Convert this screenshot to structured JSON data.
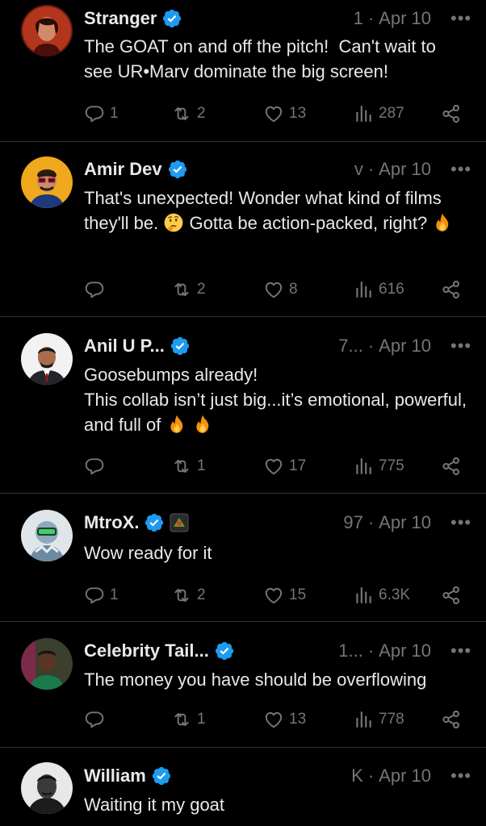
{
  "colors": {
    "background": "#000000",
    "text": "#e7e9ea",
    "muted": "#71767b",
    "verified": "#1d9bf0",
    "divider": "#2f3336"
  },
  "tweets": [
    {
      "name": "Stranger",
      "handle": "1",
      "date": "Apr 10",
      "text": "The GOAT on and off the pitch!  Can't wait to see UR•Marv dominate the big screen!",
      "replies": "1",
      "retweets": "2",
      "likes": "13",
      "views": "287"
    },
    {
      "name": "Amir Dev",
      "handle": "v",
      "date": "Apr 10",
      "text_a": "That's unexpected! Wonder what kind of films they'll be. ",
      "text_b": " Gotta be action-packed, right? ",
      "emojis": [
        "thinking-face",
        "fire"
      ],
      "replies": "",
      "retweets": "2",
      "likes": "8",
      "views": "616"
    },
    {
      "name": "Anil U P...",
      "handle": "7...",
      "date": "Apr 10",
      "text": "Goosebumps already!\nThis collab isn’t just big...it’s emotional, powerful, and full of ",
      "emojis": [
        "fire",
        "fire"
      ],
      "replies": "",
      "retweets": "1",
      "likes": "17",
      "views": "775"
    },
    {
      "name": "MtroX.",
      "handle": "97",
      "date": "Apr 10",
      "text": "Wow ready for it",
      "replies": "1",
      "retweets": "2",
      "likes": "15",
      "views": "6.3K"
    },
    {
      "name": "Celebrity Tail...",
      "handle": "1...",
      "date": "Apr 10",
      "text": "The money you have should be overflowing",
      "replies": "",
      "retweets": "1",
      "likes": "13",
      "views": "778"
    },
    {
      "name": "William",
      "handle": "K",
      "date": "Apr 10",
      "text": "Waiting it my goat"
    }
  ],
  "icons": {
    "more": "more-dots-icon",
    "reply": "reply-icon",
    "retweet": "retweet-icon",
    "like": "heart-icon",
    "views": "views-bar-chart-icon",
    "share": "share-icon",
    "verified": "verified-badge-icon"
  },
  "more_glyph": "•••",
  "dot_sep": "·"
}
